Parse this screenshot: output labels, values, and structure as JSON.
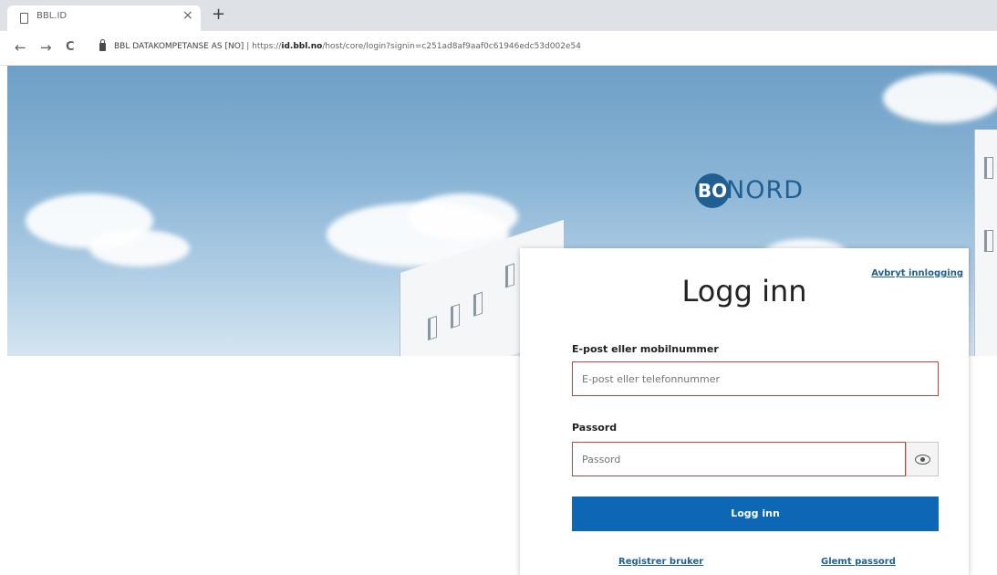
{
  "browser": {
    "tab_title": "BBL.ID",
    "tab_close": "×",
    "new_tab": "+",
    "back": "←",
    "forward": "→",
    "reload": "C",
    "org_label": "BBL DATAKOMPETANSE AS [NO]",
    "separator": "|",
    "url_prefix": "https://",
    "url_host": "id.bbl.no",
    "url_path": "/host/core/login?signin=c251ad8af9aaf0c61946edc53d002e54"
  },
  "brand": {
    "logo_mark": "BO",
    "logo_word": "NORD"
  },
  "login": {
    "cancel_link": "Avbryt innlogging",
    "title": "Logg inn",
    "email_label": "E-post eller mobilnummer",
    "email_placeholder": "E-post eller telefonnummer",
    "password_label": "Passord",
    "password_placeholder": "Passord",
    "submit_label": "Logg inn",
    "register_link": "Registrer bruker",
    "forgot_link": "Glemt passord"
  },
  "colors": {
    "accent": "#0e67b5",
    "error_border": "#b34a42",
    "brand": "#1f5f92"
  }
}
